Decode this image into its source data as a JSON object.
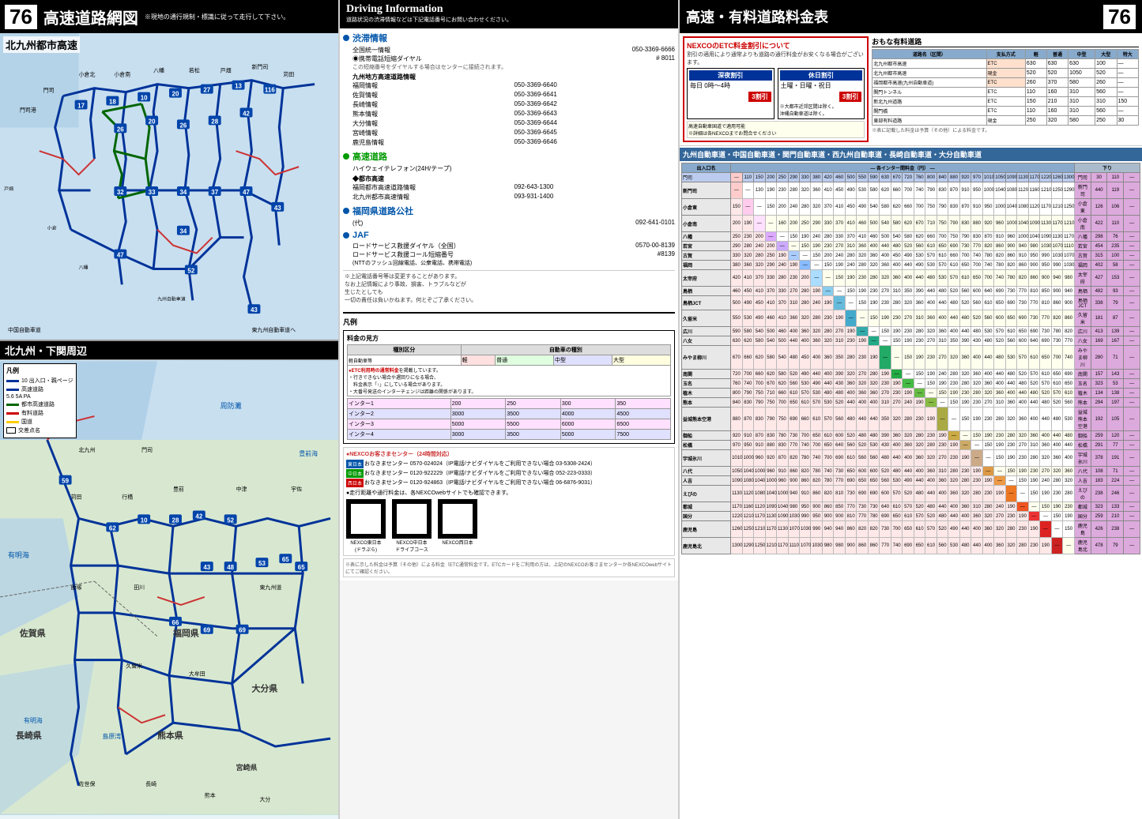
{
  "left": {
    "page_number": "76",
    "title": "高速道路網図",
    "subtitle": "※現地の通行規制・標識に従って走行して下さい。",
    "section_top": "北九州都市高速",
    "section_bottom": "北九州・下関周辺",
    "legend_items": [
      {
        "color": "#0066cc",
        "label": "10 出入口・親ページ"
      },
      {
        "color": "#0066cc",
        "label": "高速道路"
      },
      {
        "color": "#009900",
        "label": "都市高速道路"
      },
      {
        "color": "#cc0000",
        "label": "有料道路"
      },
      {
        "color": "#ffcc00",
        "label": "国道"
      },
      {
        "color": "#000",
        "label": "交差点名"
      }
    ]
  },
  "middle": {
    "title": "Driving Information",
    "subtitle": "道路状況の渋滞情報などは下記電話番号にお問い合わせください。",
    "sections": [
      {
        "id": "traffic",
        "title": "渋滞情報",
        "bullet": "blue",
        "items": [
          {
            "label": "全国統一情報",
            "value": "050-3369-6666"
          },
          {
            "label": "◉携帯電話短縮ダイヤル",
            "value": "#8011"
          },
          {
            "label": "この短縮をダイヤルする場合はセンターに接続されます。",
            "value": ""
          },
          {
            "label": "九州地方高速道路情報",
            "value": ""
          },
          {
            "label": "福岡情報",
            "value": "050-3369-6640"
          },
          {
            "label": "佐賀情報",
            "value": "050-3369-6641"
          },
          {
            "label": "長崎情報",
            "value": "050-3369-6642"
          },
          {
            "label": "熊本情報",
            "value": "050-3369-6643"
          },
          {
            "label": "大分情報",
            "value": "050-3369-6644"
          },
          {
            "label": "宮崎情報",
            "value": "050-3369-6645"
          },
          {
            "label": "鹿児島情報",
            "value": "050-3369-6646"
          }
        ]
      },
      {
        "id": "expressway",
        "title": "高速道路",
        "bullet": "green",
        "items": [
          {
            "label": "ハイウェイテレフォン(24H/テープ)",
            "value": ""
          },
          {
            "label": "◆都市高速",
            "value": ""
          },
          {
            "label": "福岡都市高速道路情報",
            "value": "092-643-1300"
          },
          {
            "label": "北九州都市高速情報",
            "value": "093-931-1400"
          }
        ]
      },
      {
        "id": "fukuoka",
        "title": "福岡県道路公社",
        "bullet": "blue",
        "items": [
          {
            "label": "(代)",
            "value": "092-641-0101"
          }
        ]
      },
      {
        "id": "jaf",
        "title": "JAF",
        "bullet": "blue",
        "items": [
          {
            "label": "ロードサービス救援ダイヤル（全国）",
            "value": "0570-00-8139"
          },
          {
            "label": "ロードサービス救援コール短縮番号",
            "value": "#8139"
          },
          {
            "label": "(NTTのフッシュ回線電話、公衆電話、携帯電話)",
            "value": ""
          }
        ]
      }
    ],
    "note": "※上記電話番号等は変更することがあります。\nなお上記情報により事故、損害、トラブルなどが\n生じたとしても\n一切の責任は負いかねます。何とぞご了承ください。"
  },
  "right": {
    "page_number": "76",
    "title": "高速・有料道路料金表",
    "legend_title": "凡例",
    "fare_legend": {
      "title": "料金の見方",
      "row1_label": "ETC利用時の通常料金",
      "note": "行きできない場合や遅回りになる場合、\n料金表示「↑」にしている場合があります。\n大番号の発送のインターチェンジは距離後に最寄の関係があります。"
    },
    "nexco_section": {
      "title": "NEXCOのETC料金割引について",
      "subtitle": "割引の適用により通常よりも道路の通行料金がお安くなる場合がございます。",
      "items": [
        {
          "title": "深夜割引",
          "detail": "毎日 0時～4時",
          "discount": "3割引"
        },
        {
          "title": "休日割引",
          "detail": "土曜・日曜・祝日",
          "discount": "3割引"
        }
      ]
    },
    "toll_table_title": "おもな有料道路",
    "toll_routes": [
      {
        "name": "福岡都市高速(九州自動車道)",
        "values": [
          "630",
          "630",
          "630",
          "100",
          ""
        ]
      },
      {
        "name": "北九州都市高速",
        "values": [
          "520",
          "520",
          "1050",
          "520",
          ""
        ]
      },
      {
        "name": "福岡都市高速(九州自動車道)",
        "values": [
          "260",
          "370",
          "580",
          "260",
          ""
        ]
      },
      {
        "name": "関門トンネル",
        "values": [
          "110",
          "160",
          "310",
          "560",
          ""
        ]
      },
      {
        "name": "新北九州道路",
        "values": [
          "150",
          "210",
          "310",
          "310",
          "150"
        ]
      },
      {
        "name": "関門橋",
        "values": [
          "110",
          "160",
          "310",
          "560",
          ""
        ]
      },
      {
        "name": "東部有料道路",
        "values": [
          "250",
          "320",
          "580",
          "250",
          "30"
        ]
      }
    ],
    "main_table_title": "九州自動車道・中国自動車道・関門自動車道・西九州自動車道・長崎自動車道・大分自動車道"
  },
  "icons": {
    "bullet_blue": "●",
    "bullet_green": "●",
    "number_76": "76"
  }
}
